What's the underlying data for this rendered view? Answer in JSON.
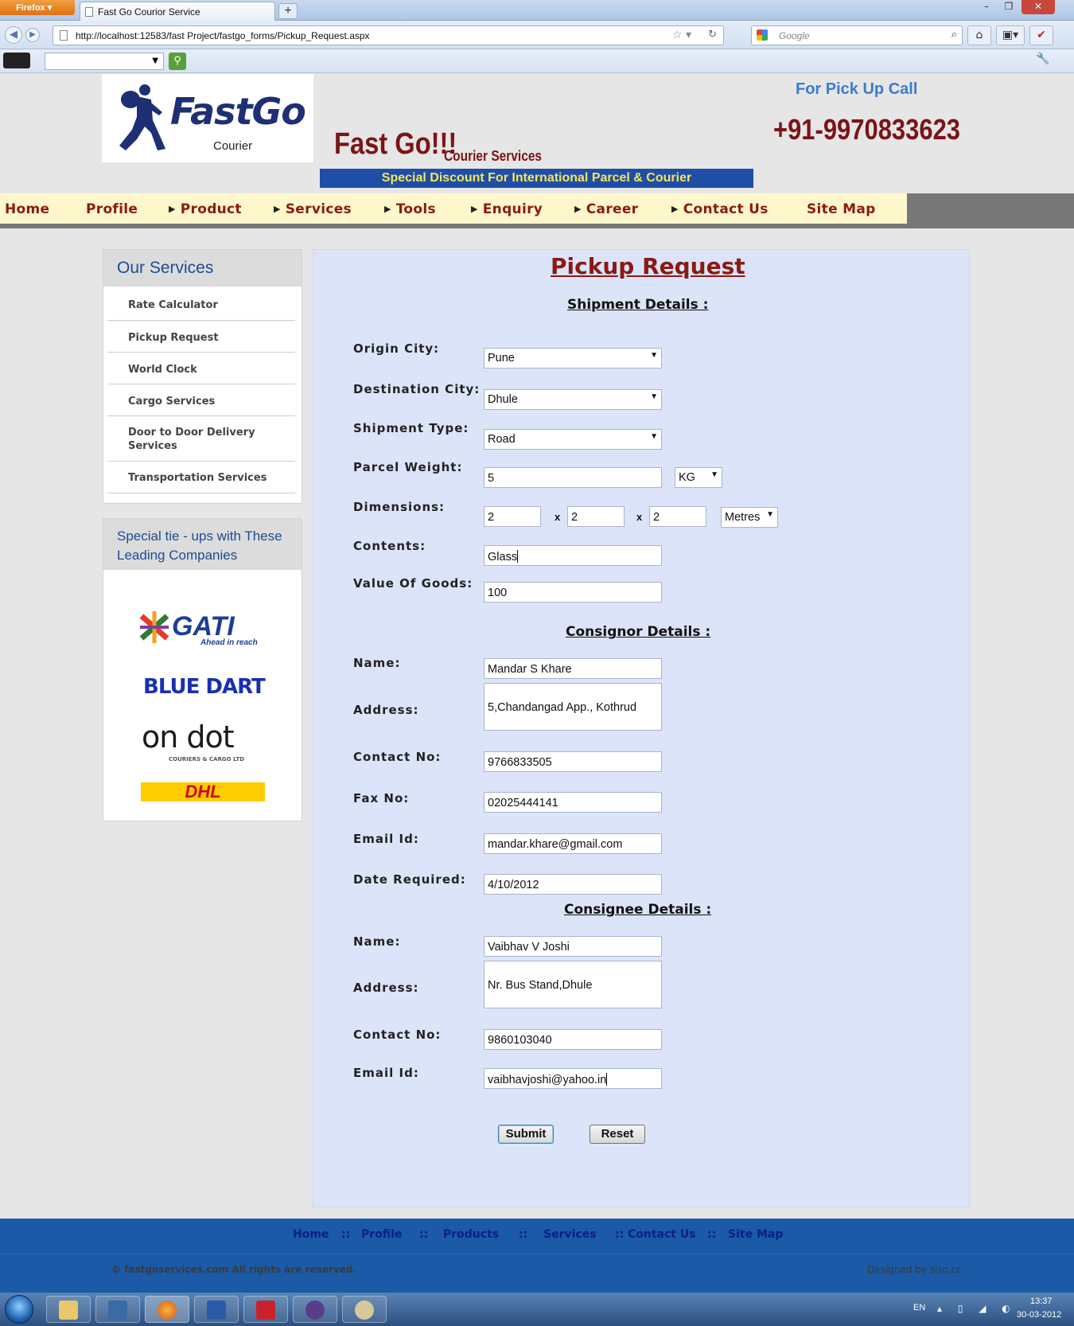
{
  "browser": {
    "app_button": "Firefox",
    "tab_title": "Fast Go Courior Service",
    "new_tab": "+",
    "url": "http://localhost:12583/fast Project/fastgo_forms/Pickup_Request.aspx",
    "search_placeholder": "Google"
  },
  "header": {
    "logo_text": "FastGo",
    "logo_sub": "Courier",
    "brand": "Fast Go!!!",
    "brand_sub": "Courier Services",
    "discount": "Special Discount For International Parcel & Courier",
    "call_heading": "For Pick Up Call",
    "phone": "+91-9970833623"
  },
  "menu": [
    {
      "label": "Home",
      "arrow": false
    },
    {
      "label": "Profile",
      "arrow": false
    },
    {
      "label": "Product",
      "arrow": true
    },
    {
      "label": "Services",
      "arrow": true
    },
    {
      "label": "Tools",
      "arrow": true
    },
    {
      "label": "Enquiry",
      "arrow": true
    },
    {
      "label": "Career",
      "arrow": true
    },
    {
      "label": "Contact Us",
      "arrow": true
    },
    {
      "label": "Site Map",
      "arrow": false
    }
  ],
  "sidebar": {
    "services_heading": "Our Services",
    "services": [
      "Rate Calculator",
      "Pickup Request",
      "World Clock",
      "Cargo Services",
      "Door to Door Delivery Services",
      "Transportation Services"
    ],
    "tieups_heading": "Special tie - ups with These Leading Companies",
    "partners": {
      "gati": "GATI",
      "gati_tag": "Ahead in reach",
      "bluedart": "BLUE DART",
      "ondot": "on dot",
      "ondot_sub": "COURIERS & CARGO LTD",
      "dhl": "DHL"
    }
  },
  "form": {
    "title": "Pickup Request",
    "shipment_heading": "Shipment Details :",
    "consignor_heading": "Consignor Details :",
    "consignee_heading": "Consignee Details :",
    "labels": {
      "origin_city": "Origin City:",
      "destination_city": "Destination City:",
      "shipment_type": "Shipment Type:",
      "parcel_weight": "Parcel Weight:",
      "dimensions": "Dimensions:",
      "contents": "Contents:",
      "value_of_goods": "Value Of Goods:",
      "name": "Name:",
      "address": "Address:",
      "contact_no": "Contact No:",
      "fax_no": "Fax No:",
      "email_id": "Email Id:",
      "date_required": "Date Required:"
    },
    "shipment": {
      "origin_city": "Pune",
      "destination_city": "Dhule",
      "shipment_type": "Road",
      "parcel_weight": "5",
      "weight_unit": "KG",
      "dim1": "2",
      "dim2": "2",
      "dim3": "2",
      "dim_sep": "x",
      "dim_unit": "Metres",
      "contents": "Glass",
      "value_of_goods": "100"
    },
    "consignor": {
      "name": "Mandar S Khare",
      "address": "5,Chandangad App., Kothrud",
      "contact_no": "9766833505",
      "fax_no": "02025444141",
      "email": "mandar.khare@gmail.com",
      "date_required": "4/10/2012"
    },
    "consignee": {
      "name": "Vaibhav V Joshi",
      "address": "Nr. Bus Stand,Dhule",
      "contact_no": "9860103040",
      "email": "vaibhavjoshi@yahoo.in"
    },
    "submit_label": "Submit",
    "reset_label": "Reset"
  },
  "footer": {
    "links": [
      "Home",
      "Profile",
      "Products",
      "Services",
      "Contact Us",
      "Site Map"
    ],
    "sep": "::",
    "copyright": "© fastgoservices.com All rights are reserved.",
    "designed_by": "Designed by siso.cc"
  },
  "taskbar": {
    "lang": "EN",
    "time": "13:37",
    "date": "30-03-2012"
  },
  "colors": {
    "brand_red": "#7a1417",
    "menu_bg": "#fff7cc",
    "panel_bg": "#dbe4f8",
    "footer_blue": "#1a5aa6",
    "link_blue": "#1b4c93"
  }
}
